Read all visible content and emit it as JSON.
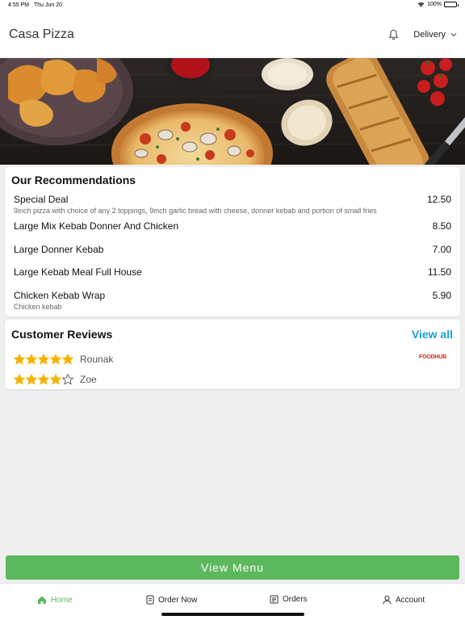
{
  "status": {
    "time": "4:55 PM",
    "date": "Thu Jun 20",
    "battery": "100%"
  },
  "header": {
    "title": "Casa Pizza",
    "order_mode": "Delivery"
  },
  "recommendations": {
    "title": "Our Recommendations",
    "items": [
      {
        "name": "Special Deal",
        "desc": "9inch pizza with choice of any 2 toppings,  9inch garlic bread with cheese, donner kebab and portion of small fries",
        "price": "12.50"
      },
      {
        "name": "Large Mix Kebab Donner And Chicken",
        "desc": "",
        "price": "8.50"
      },
      {
        "name": "Large Donner Kebab",
        "desc": "",
        "price": "7.00"
      },
      {
        "name": "Large Kebab Meal Full House",
        "desc": "",
        "price": "11.50"
      },
      {
        "name": "Chicken Kebab Wrap",
        "desc": "Chicken kebab",
        "price": "5.90"
      }
    ]
  },
  "reviews": {
    "title": "Customer Reviews",
    "view_all": "View all",
    "source_logo": "FOODHUB",
    "items": [
      {
        "name": "Rounak",
        "rating": 5,
        "max": 5
      },
      {
        "name": "Zoe",
        "rating": 4,
        "max": 5
      }
    ]
  },
  "cta": {
    "label": "View Menu"
  },
  "tabs": [
    {
      "label": "Home",
      "icon": "home-icon"
    },
    {
      "label": "Order Now",
      "icon": "order-icon"
    },
    {
      "label": "Orders",
      "icon": "receipt-icon"
    },
    {
      "label": "Account",
      "icon": "user-icon"
    }
  ],
  "colors": {
    "primary_green": "#5cb85c",
    "link_blue": "#1a9fd6",
    "star": "#f5b301"
  }
}
